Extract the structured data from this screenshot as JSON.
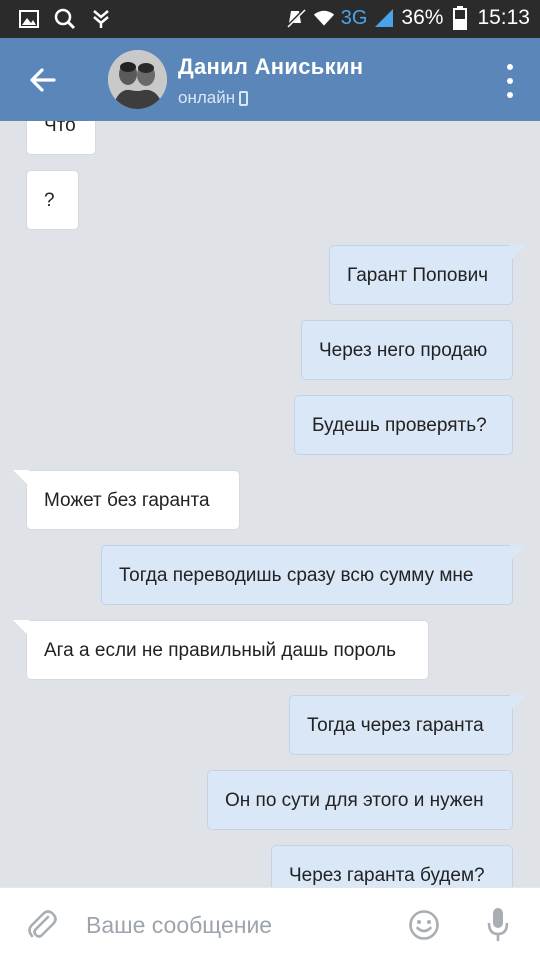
{
  "status_bar": {
    "network": "3G",
    "battery": "36%",
    "time": "15:13",
    "icons": [
      "gallery-icon",
      "search-icon",
      "vk-icon",
      "mute-icon",
      "wifi-icon",
      "signal-icon",
      "battery-icon"
    ]
  },
  "header": {
    "name": "Данил Аниськин",
    "status": "онлайн"
  },
  "messages": [
    {
      "text": "Что",
      "dir": "in"
    },
    {
      "text": "?",
      "dir": "in"
    },
    {
      "text": "Гарант Попович",
      "dir": "out"
    },
    {
      "text": "Через него продаю",
      "dir": "out"
    },
    {
      "text": "Будешь проверять?",
      "dir": "out"
    },
    {
      "text": "Может без гаранта",
      "dir": "in"
    },
    {
      "text": "Тогда переводишь сразу всю сумму мне",
      "dir": "out"
    },
    {
      "text": "Ага а если не правильный дашь пороль",
      "dir": "in"
    },
    {
      "text": "Тогда через гаранта",
      "dir": "out"
    },
    {
      "text": "Он по сути для этого и нужен",
      "dir": "out"
    },
    {
      "text": "Через гаранта будем?",
      "dir": "out"
    }
  ],
  "composer": {
    "placeholder": "Ваше сообщение"
  },
  "colors": {
    "header": "#5b86b9",
    "background": "#dfe3e8",
    "incoming_bubble": "#ffffff",
    "outgoing_bubble": "#d9e7f7"
  }
}
